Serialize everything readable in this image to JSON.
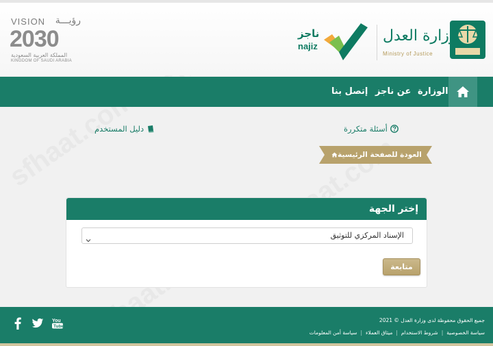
{
  "header": {
    "vision": {
      "title": "VISION",
      "title_ar": "رؤيـــة",
      "year": "2030",
      "kingdom_ar": "المملكة العربية السعودية",
      "kingdom_en": "KINGDOM OF SAUDI ARABIA"
    },
    "najiz": {
      "name_ar": "ناجز",
      "name_en": "najiz"
    },
    "ministry": {
      "name_ar": "وزارة العدل",
      "name_en": "Ministry of Justice"
    }
  },
  "nav": {
    "home_icon": "home-icon",
    "items": [
      {
        "label": "الوزارة"
      },
      {
        "label": "عن ناجز"
      },
      {
        "label": "إتصل بنا"
      }
    ]
  },
  "quick_links": {
    "faq": "أسئلة متكررة",
    "guide": "دليل المستخدم"
  },
  "breadcrumb": {
    "back_home": "العودة للصفحة الرئيسية"
  },
  "panel": {
    "title": "إختر الجهة",
    "select_value": "الإسناد المركزي للتوثيق",
    "continue_label": "متابعة"
  },
  "footer": {
    "copyright": "جميع الحقوق محفوظة لدى وزارة العدل © 2021",
    "links": [
      "سياسة الخصوصية",
      "شروط الاستخدام",
      "ميثاق العملاء",
      "سياسة أمن المعلومات"
    ],
    "social": [
      "youtube-icon",
      "twitter-icon",
      "facebook-icon"
    ]
  },
  "colors": {
    "primary": "#1a7d68",
    "gold": "#b8a26c"
  }
}
